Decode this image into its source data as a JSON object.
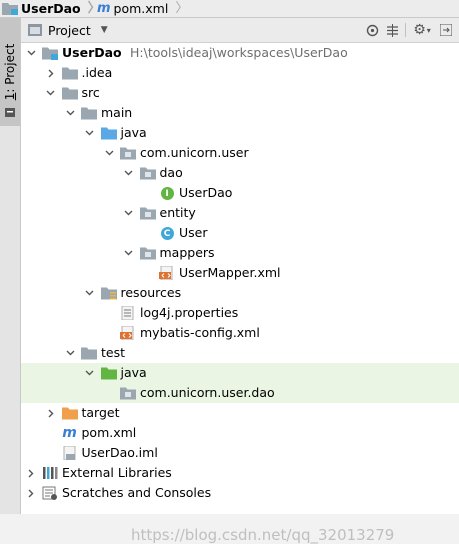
{
  "breadcrumb": {
    "project": "UserDao",
    "file": "pom.xml"
  },
  "tool_window": {
    "stripe_number": "1",
    "stripe_label": ": Project",
    "view_mode": "Project"
  },
  "header_icons": [
    "crosshair-icon",
    "collapse-icon",
    "gear-icon",
    "hide-icon"
  ],
  "tree": [
    {
      "label": "UserDao",
      "extra": "H:\\tools\\ideaj\\workspaces\\UserDao",
      "depth": 0,
      "arrow": "down",
      "icon": "module-folder",
      "bold": true
    },
    {
      "label": ".idea",
      "depth": 1,
      "arrow": "right",
      "icon": "folder-gray"
    },
    {
      "label": "src",
      "depth": 1,
      "arrow": "down",
      "icon": "folder-gray"
    },
    {
      "label": "main",
      "depth": 2,
      "arrow": "down",
      "icon": "folder-gray"
    },
    {
      "label": "java",
      "depth": 3,
      "arrow": "down",
      "icon": "folder-blue"
    },
    {
      "label": "com.unicorn.user",
      "depth": 4,
      "arrow": "down",
      "icon": "package"
    },
    {
      "label": "dao",
      "depth": 5,
      "arrow": "down",
      "icon": "package"
    },
    {
      "label": "UserDao",
      "depth": 6,
      "arrow": "none",
      "icon": "interface"
    },
    {
      "label": "entity",
      "depth": 5,
      "arrow": "down",
      "icon": "package"
    },
    {
      "label": "User",
      "depth": 6,
      "arrow": "none",
      "icon": "class"
    },
    {
      "label": "mappers",
      "depth": 5,
      "arrow": "down",
      "icon": "package"
    },
    {
      "label": "UserMapper.xml",
      "depth": 6,
      "arrow": "none",
      "icon": "xml"
    },
    {
      "label": "resources",
      "depth": 3,
      "arrow": "down",
      "icon": "folder-resources"
    },
    {
      "label": "log4j.properties",
      "depth": 4,
      "arrow": "none",
      "icon": "properties"
    },
    {
      "label": "mybatis-config.xml",
      "depth": 4,
      "arrow": "none",
      "icon": "xml"
    },
    {
      "label": "test",
      "depth": 2,
      "arrow": "down",
      "icon": "folder-gray"
    },
    {
      "label": "java",
      "depth": 3,
      "arrow": "down",
      "icon": "folder-green",
      "highlight": true
    },
    {
      "label": "com.unicorn.user.dao",
      "depth": 4,
      "arrow": "none",
      "icon": "package",
      "highlight": true
    },
    {
      "label": "target",
      "depth": 1,
      "arrow": "right",
      "icon": "folder-orange"
    },
    {
      "label": "pom.xml",
      "depth": 1,
      "arrow": "none",
      "icon": "maven"
    },
    {
      "label": "UserDao.iml",
      "depth": 1,
      "arrow": "none",
      "icon": "iml"
    },
    {
      "label": "External Libraries",
      "depth": 0,
      "arrow": "right",
      "icon": "libraries"
    },
    {
      "label": "Scratches and Consoles",
      "depth": 0,
      "arrow": "right",
      "icon": "scratches"
    }
  ],
  "watermark": "https://blog.csdn.net/qq_32013279",
  "colors": {
    "folder_gray": "#9aa7b0",
    "folder_blue": "#5aa9e6",
    "folder_green": "#62b543",
    "folder_orange": "#f0a04b",
    "interface_badge": "#62b543",
    "class_badge": "#40a8d8",
    "maven": "#3a7fd5",
    "highlight_row": "#eaf6e3"
  }
}
